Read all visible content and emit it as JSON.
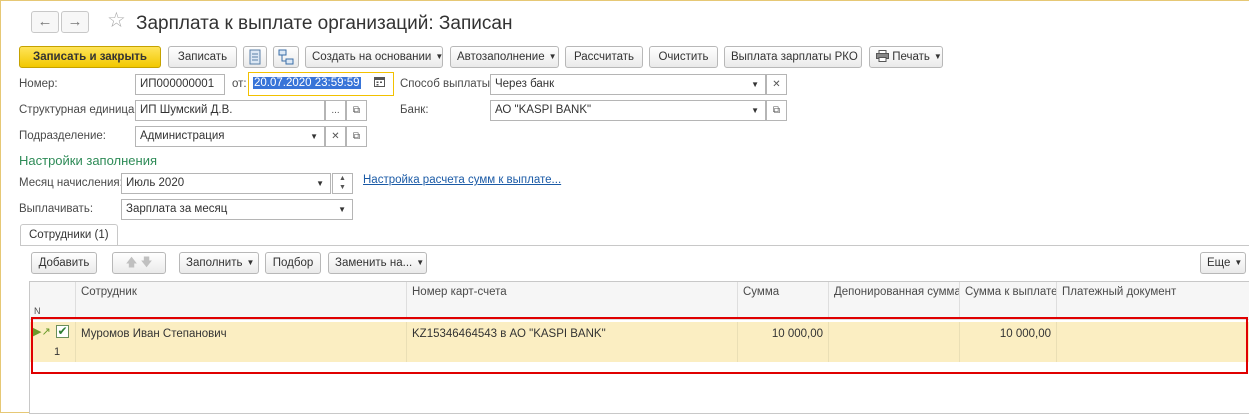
{
  "window": {
    "title": "Зарплата к выплате организаций: Записан",
    "back_icon": "←",
    "forward_icon": "→",
    "favorite_icon": "☆"
  },
  "toolbar": {
    "save_close": "Записать и закрыть",
    "save": "Записать",
    "create_based": "Создать на основании",
    "autofill": "Автозаполнение",
    "calculate": "Рассчитать",
    "clear": "Очистить",
    "salary_rko": "Выплата зарплаты РКО",
    "print": "Печать"
  },
  "form": {
    "number_label": "Номер:",
    "number_value": "ИП000000001",
    "date_label": "от:",
    "date_value": "20.07.2020 23:59:59",
    "pay_method_label": "Способ выплаты:",
    "pay_method_value": "Через банк",
    "unit_label": "Структурная единица:",
    "unit_value": "ИП Шумский Д.В.",
    "bank_label": "Банк:",
    "bank_value": "АО \"KASPI BANK\"",
    "department_label": "Подразделение:",
    "department_value": "Администрация"
  },
  "fill_settings": {
    "title": "Настройки заполнения",
    "month_label": "Месяц начисления:",
    "month_value": "Июль 2020",
    "link_text": "Настройка расчета сумм к выплате...",
    "pay_label": "Выплачивать:",
    "pay_value": "Зарплата за месяц"
  },
  "tabs": [
    {
      "label": "Сотрудники (1)"
    }
  ],
  "table_toolbar": {
    "add": "Добавить",
    "fill": "Заполнить",
    "pick": "Подбор",
    "replace": "Заменить на...",
    "more": "Еще"
  },
  "table": {
    "row_num_header": "N",
    "columns": [
      "Сотрудник",
      "Номер карт-счета",
      "Сумма",
      "Депонированная сумма",
      "Сумма к выплате",
      "Платежный документ"
    ],
    "rows": [
      {
        "num": "1",
        "checked": true,
        "employee": "Муромов Иван Степанович",
        "account": "KZ15346464543 в АО \"KASPI BANK\"",
        "amount": "10 000,00",
        "deposited": "",
        "to_pay": "10 000,00",
        "pay_doc": ""
      }
    ]
  },
  "colors": {
    "accent_yellow": "#f2c800",
    "selected_row": "#fbeec2",
    "highlight_red": "#e00000",
    "section_green": "#2e8b57",
    "link_blue": "#1a5aa6"
  }
}
